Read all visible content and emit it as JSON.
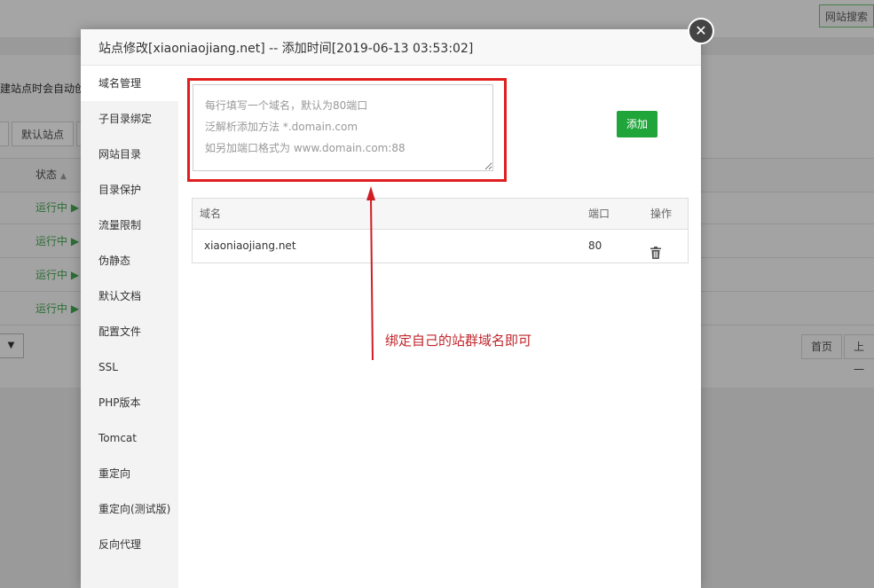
{
  "background": {
    "search_button": "网站搜索",
    "notice_text": "建站点时会自动创",
    "default_site_button": "默认站点",
    "status_header": "状态",
    "rows": [
      {
        "status": "运行中"
      },
      {
        "status": "运行中"
      },
      {
        "status": "运行中"
      },
      {
        "status": "运行中"
      }
    ],
    "pagination": {
      "first": "首页",
      "prev": "上一"
    }
  },
  "dialog": {
    "title": "站点修改[xiaoniaojiang.net] -- 添加时间[2019-06-13 03:53:02]",
    "close_symbol": "✕",
    "sidebar": [
      {
        "label": "域名管理",
        "active": true
      },
      {
        "label": "子目录绑定"
      },
      {
        "label": "网站目录"
      },
      {
        "label": "目录保护"
      },
      {
        "label": "流量限制"
      },
      {
        "label": "伪静态"
      },
      {
        "label": "默认文档"
      },
      {
        "label": "配置文件"
      },
      {
        "label": "SSL"
      },
      {
        "label": "PHP版本"
      },
      {
        "label": "Tomcat"
      },
      {
        "label": "重定向"
      },
      {
        "label": "重定向(测试版)"
      },
      {
        "label": "反向代理"
      }
    ],
    "domain_input": {
      "placeholder": "每行填写一个域名，默认为80端口\n泛解析添加方法 *.domain.com\n如另加端口格式为 www.domain.com:88",
      "value": ""
    },
    "add_button": "添加",
    "table": {
      "headers": {
        "domain": "域名",
        "port": "端口",
        "action": "操作"
      },
      "rows": [
        {
          "domain": "xiaoniaojiang.net",
          "port": "80",
          "action_icon": "trash-icon"
        }
      ]
    }
  },
  "annotation": {
    "text": "绑定自己的站群域名即可",
    "color": "#c0252b"
  },
  "colors": {
    "accent_green": "#20a53a",
    "highlight_red": "#e01e1e"
  }
}
